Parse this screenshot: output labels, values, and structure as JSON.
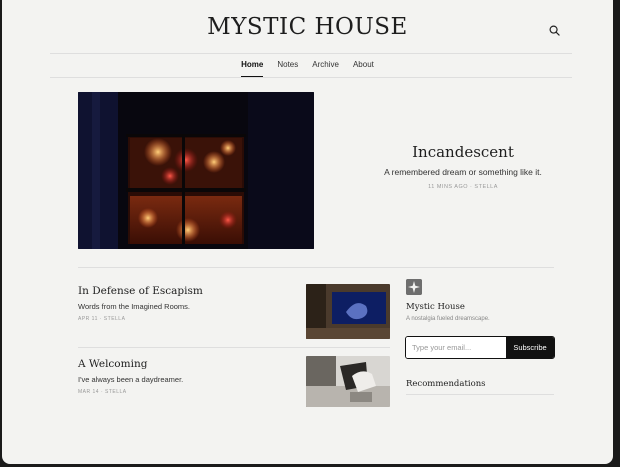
{
  "site": {
    "name": "MYSTIC HOUSE"
  },
  "nav": {
    "items": [
      "Home",
      "Notes",
      "Archive",
      "About"
    ]
  },
  "hero": {
    "title": "Incandescent",
    "subtitle": "A remembered dream or something like it.",
    "meta": "11 MINS AGO · STELLA"
  },
  "posts": [
    {
      "title": "In Defense of Escapism",
      "excerpt": "Words from the Imagined Rooms.",
      "meta": "APR 11 · STELLA"
    },
    {
      "title": "A Welcoming",
      "excerpt": "I've always been a daydreamer.",
      "meta": "MAR 14 · STELLA"
    }
  ],
  "sidebar": {
    "site_name": "Mystic House",
    "description": "A nostalgia fueled dreamscape.",
    "email_placeholder": "Type your email...",
    "subscribe_label": "Subscribe",
    "recommendations_heading": "Recommendations"
  },
  "icons": {
    "search": "search-icon"
  }
}
